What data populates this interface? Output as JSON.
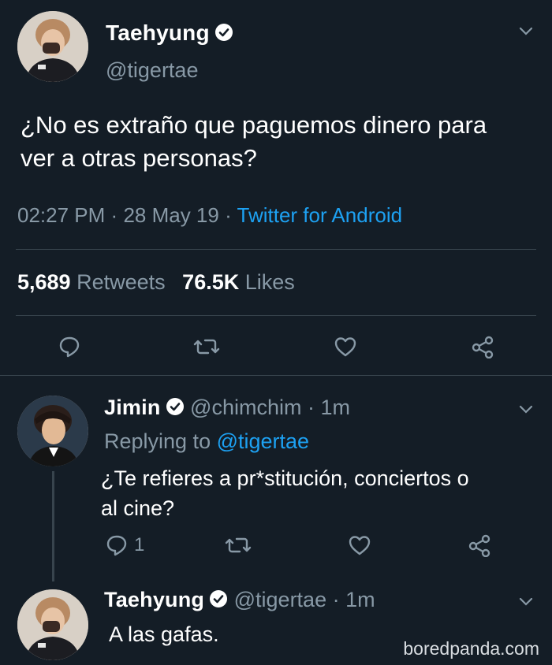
{
  "colors": {
    "background": "#141d26",
    "text": "#ffffff",
    "muted": "#8899a6",
    "link": "#1da1f2",
    "divider": "#38444d"
  },
  "main_tweet": {
    "display_name": "Taehyung",
    "handle": "@tigertae",
    "text_line1": "¿No es extraño que paguemos dinero para",
    "text_line2": "ver a otras personas?",
    "time": "02:27 PM",
    "sep1": "·",
    "date": "28 May 19",
    "sep2": "·",
    "source": "Twitter for Android",
    "retweets_count": "5,689",
    "retweets_label": "Retweets",
    "likes_count": "76.5K",
    "likes_label": "Likes",
    "icons": [
      "reply-icon",
      "retweet-icon",
      "like-icon",
      "share-icon"
    ]
  },
  "reply_1": {
    "display_name": "Jimin",
    "handle": "@chimchim",
    "sep": "·",
    "time": "1m",
    "replying_prefix": "Replying to",
    "replying_handle": "@tigertae",
    "text_line1": "¿Te refieres a pr*stitución, conciertos o",
    "text_line2": "al cine?",
    "reply_count": "1"
  },
  "reply_2": {
    "display_name": "Taehyung",
    "handle": "@tigertae",
    "sep": "·",
    "time": "1m",
    "text": "A las gafas."
  },
  "watermark": "boredpanda.com"
}
